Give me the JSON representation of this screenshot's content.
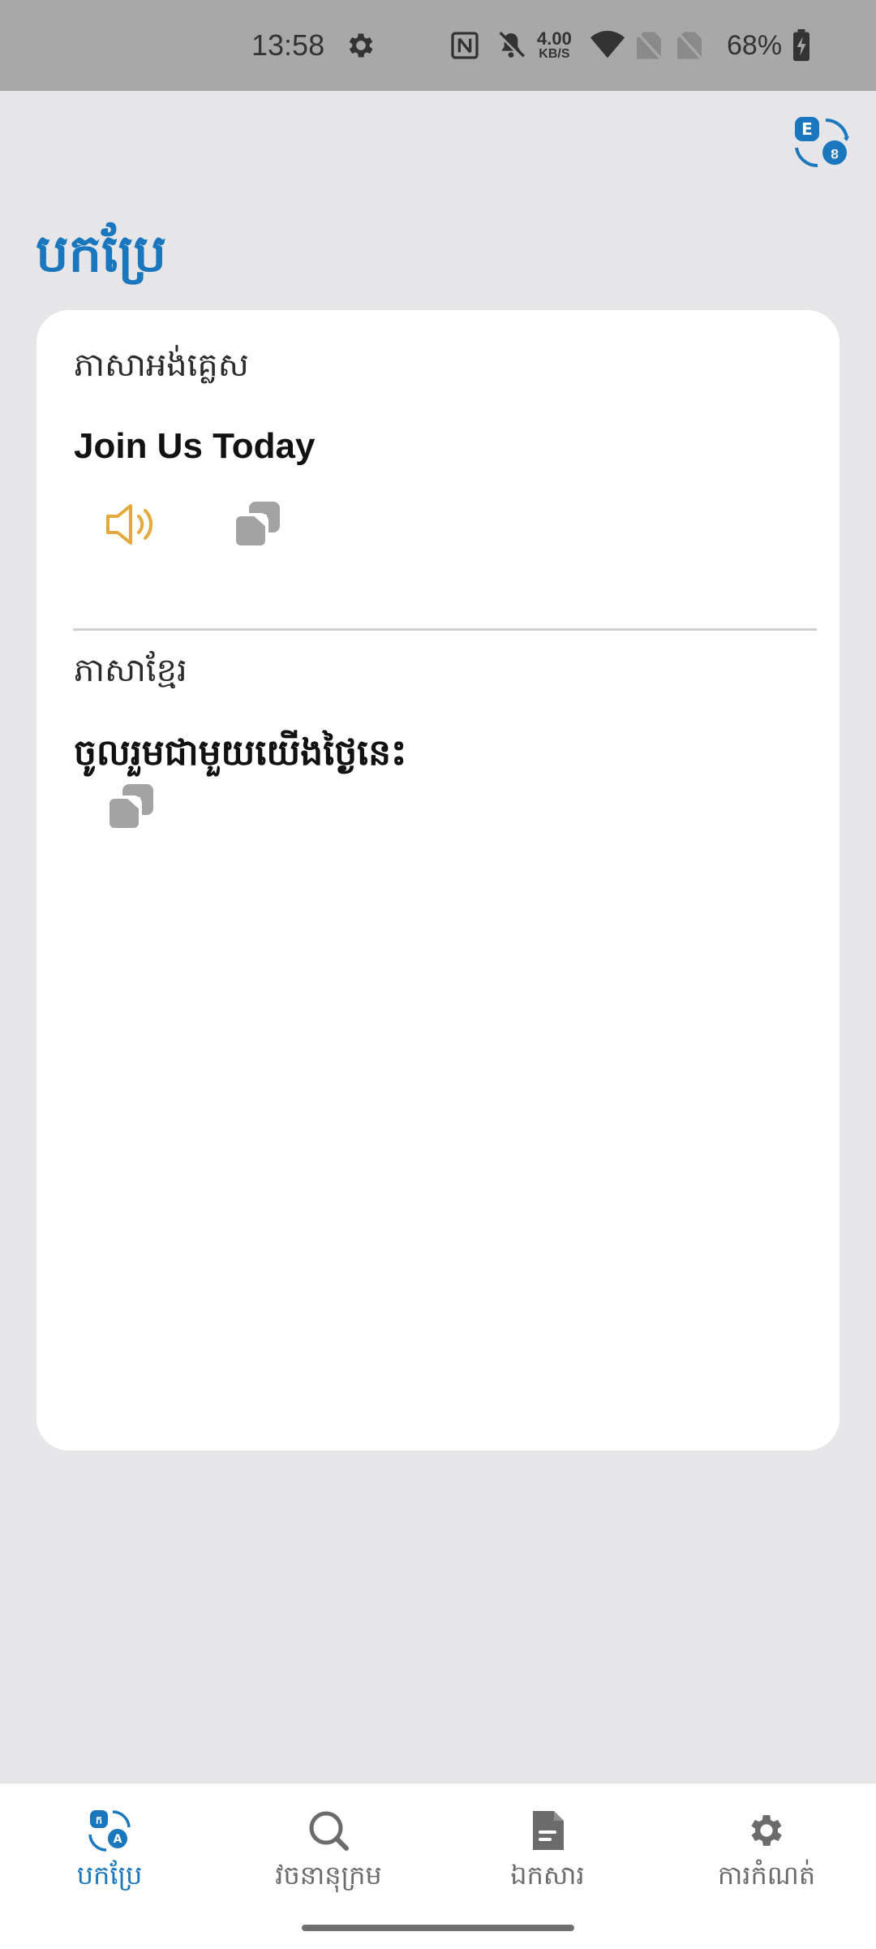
{
  "status_bar": {
    "time": "13:58",
    "net_speed_value": "4.00",
    "net_speed_unit": "KB/S",
    "battery": "68%"
  },
  "header": {
    "title": "បកប្រែ",
    "swap_icon_letters": [
      "E",
      "ខ"
    ]
  },
  "card": {
    "source": {
      "language": "ភាសាអង់គ្លេស",
      "text": "Join Us Today"
    },
    "target": {
      "language": "ភាសាខ្មែរ",
      "text": "ចូលរួមជាមួយយើងថ្ងៃនេះ"
    }
  },
  "bottom_nav": {
    "items": [
      {
        "label": "បកប្រែ",
        "icon": "translate-icon",
        "active": true
      },
      {
        "label": "វចនានុក្រម",
        "icon": "search-icon",
        "active": false
      },
      {
        "label": "ឯកសារ",
        "icon": "document-icon",
        "active": false
      },
      {
        "label": "ការកំណត់",
        "icon": "gear-icon",
        "active": false
      }
    ]
  },
  "colors": {
    "accent": "#1a77bd",
    "speaker": "#e3a93c",
    "icon_gray": "#a3a3a3",
    "background": "#e6e6e8",
    "status_bar": "#a8a8a9"
  }
}
